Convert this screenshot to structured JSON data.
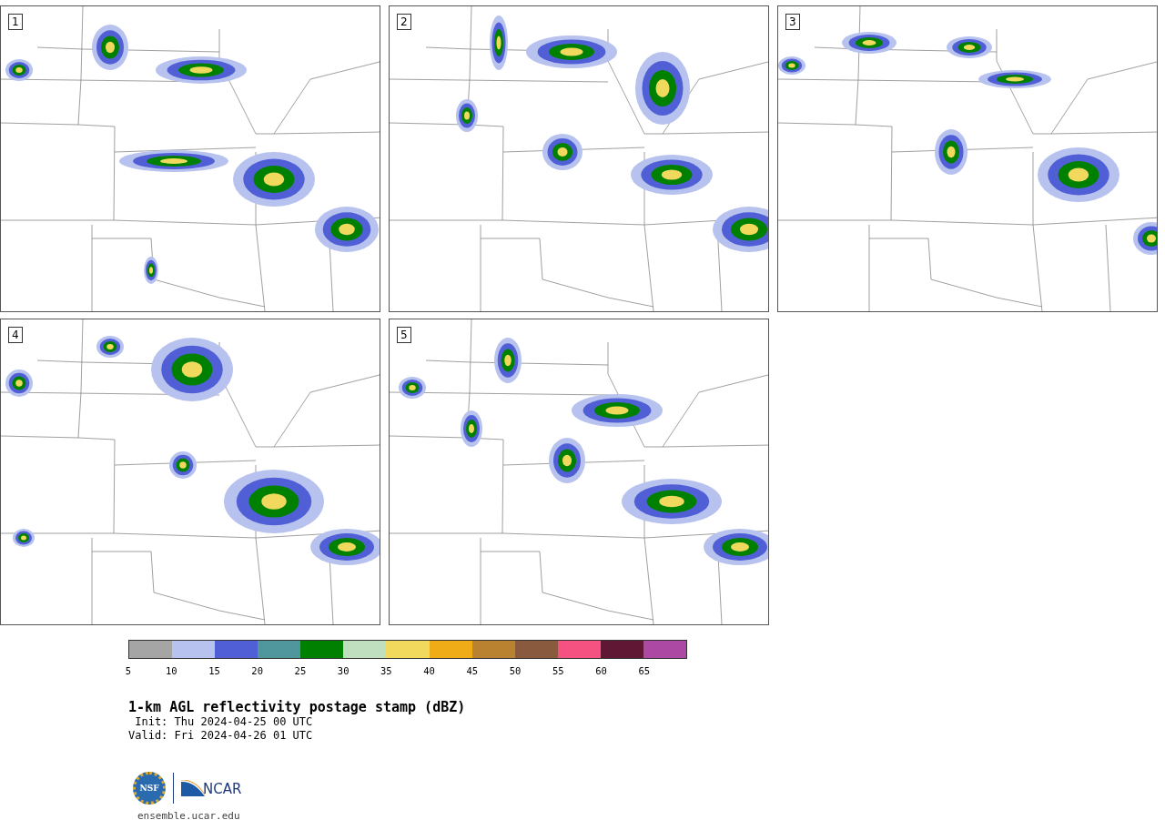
{
  "panels": [
    {
      "label": "1"
    },
    {
      "label": "2"
    },
    {
      "label": "3"
    },
    {
      "label": "4"
    },
    {
      "label": "5"
    }
  ],
  "colorbar": {
    "bins": [
      {
        "color": "#a5a5a5"
      },
      {
        "color": "#b7c2ee"
      },
      {
        "color": "#505fd6"
      },
      {
        "color": "#4f979c"
      },
      {
        "color": "#008000"
      },
      {
        "color": "#bfdfbf"
      },
      {
        "color": "#f0d95c"
      },
      {
        "color": "#f0ac17"
      },
      {
        "color": "#b88230"
      },
      {
        "color": "#8a5a3f"
      },
      {
        "color": "#f55281"
      },
      {
        "color": "#601733"
      },
      {
        "color": "#ac4aa3"
      }
    ],
    "ticks": [
      "5",
      "10",
      "15",
      "20",
      "25",
      "30",
      "35",
      "40",
      "45",
      "50",
      "55",
      "60",
      "65"
    ]
  },
  "title": "1-km AGL reflectivity postage stamp (dBZ)",
  "init": " Init: Thu 2024-04-25 00 UTC",
  "valid": "Valid: Fri 2024-04-26 01 UTC",
  "logos": {
    "nsf": "NSF",
    "ncar": "NCAR"
  },
  "url": "ensemble.ucar.edu"
}
